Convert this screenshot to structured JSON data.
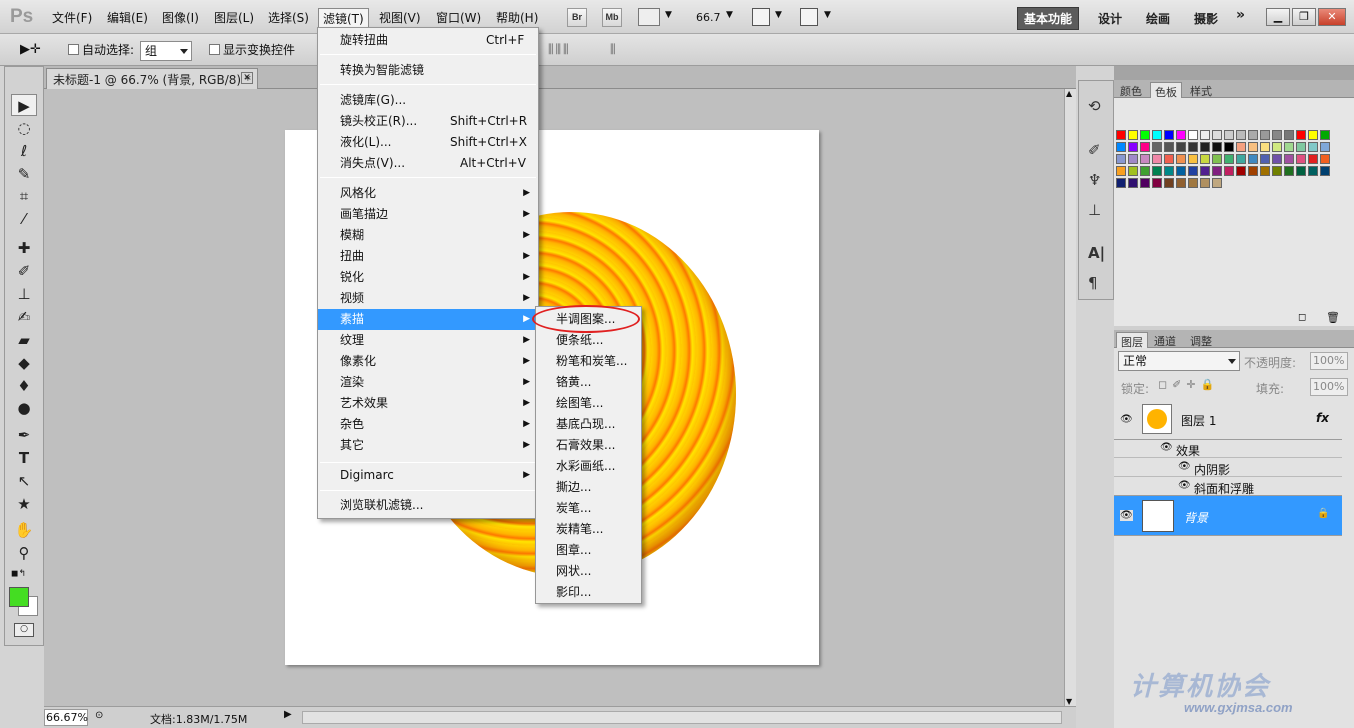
{
  "app": {
    "logo": "Ps"
  },
  "menubar": {
    "items": [
      "文件(F)",
      "编辑(E)",
      "图像(I)",
      "图层(L)",
      "选择(S)",
      "滤镜(T)",
      "视图(V)",
      "窗口(W)",
      "帮助(H)"
    ],
    "zoom": "66.7",
    "bridge_btn": "Br",
    "minibridge_btn": "Mb",
    "workspaces": [
      "基本功能",
      "设计",
      "绘画",
      "摄影"
    ],
    "more": "»"
  },
  "options": {
    "auto_select_label": "自动选择:",
    "auto_select_value": "组",
    "show_transform_label": "显示变换控件"
  },
  "document": {
    "tab_title": "未标题-1 @ 66.7% (背景, RGB/8) *"
  },
  "status": {
    "zoom": "66.67%",
    "doc_info": "文档:1.83M/1.75M"
  },
  "panels": {
    "color_tabs": [
      "颜色",
      "色板",
      "样式"
    ],
    "layer_tabs": [
      "图层",
      "通道",
      "调整"
    ],
    "blend_mode": "正常",
    "opacity_label": "不透明度:",
    "opacity_value": "100%",
    "lock_label": "锁定:",
    "fill_label": "填充:",
    "fill_value": "100%",
    "layers": [
      {
        "name": "图层 1",
        "fx": "fx"
      },
      {
        "name": "背景"
      }
    ],
    "effects_label": "效果",
    "effects": [
      "内阴影",
      "斜面和浮雕"
    ]
  },
  "filter_menu": {
    "top": [
      {
        "label": "旋转扭曲",
        "shortcut": "Ctrl+F"
      }
    ],
    "smart": "转换为智能滤镜",
    "group2": [
      {
        "label": "滤镜库(G)...",
        "shortcut": ""
      },
      {
        "label": "镜头校正(R)...",
        "shortcut": "Shift+Ctrl+R"
      },
      {
        "label": "液化(L)...",
        "shortcut": "Shift+Ctrl+X"
      },
      {
        "label": "消失点(V)...",
        "shortcut": "Alt+Ctrl+V"
      }
    ],
    "submenus": [
      "风格化",
      "画笔描边",
      "模糊",
      "扭曲",
      "锐化",
      "视频",
      "素描",
      "纹理",
      "像素化",
      "渲染",
      "艺术效果",
      "杂色",
      "其它"
    ],
    "digimarc": "Digimarc",
    "browse": "浏览联机滤镜..."
  },
  "sketch_menu": {
    "items": [
      "半调图案...",
      "便条纸...",
      "粉笔和炭笔...",
      "铬黄...",
      "绘图笔...",
      "基底凸现...",
      "石膏效果...",
      "水彩画纸...",
      "撕边...",
      "炭笔...",
      "炭精笔...",
      "图章...",
      "网状...",
      "影印..."
    ]
  },
  "watermark": {
    "text": "计算机协会",
    "url": "www.gxjmsa.com"
  },
  "colors": {
    "highlight": "#3399ff",
    "foreground": "#44dd22",
    "annotation": "#e02020"
  },
  "swatch_colors": [
    "#ff0000",
    "#ffff00",
    "#00ff00",
    "#00ffff",
    "#0000ff",
    "#ff00ff",
    "#ffffff",
    "#eeeeee",
    "#dddddd",
    "#cccccc",
    "#bbbbbb",
    "#aaaaaa",
    "#999999",
    "#888888",
    "#777777",
    "#ff0000",
    "#ffff00",
    "#00aa00",
    "#0088ff",
    "#8800ff",
    "#ff0088",
    "#666666",
    "#555555",
    "#444444",
    "#333333",
    "#222222",
    "#111111",
    "#000000",
    "#f4a080",
    "#f8c080",
    "#fbe080",
    "#d0e880",
    "#a0d890",
    "#80c8a0",
    "#80c8c8",
    "#80a8d8",
    "#8898d0",
    "#a088c8",
    "#c888c0",
    "#f088a8",
    "#f06050",
    "#f09050",
    "#f8c040",
    "#c8d840",
    "#80c050",
    "#40b070",
    "#40a8a0",
    "#4088c0",
    "#5060b0",
    "#7050a8",
    "#a050a0",
    "#e05080",
    "#e02020",
    "#f06020",
    "#f8a020",
    "#a0c020",
    "#40a030",
    "#008050",
    "#008888",
    "#0060a0",
    "#2040a0",
    "#502090",
    "#802080",
    "#c02060",
    "#a00000",
    "#a04000",
    "#a07000",
    "#708000",
    "#207020",
    "#006040",
    "#006060",
    "#004070",
    "#102070",
    "#301070",
    "#500060",
    "#800040",
    "#704020",
    "#906030",
    "#a07840",
    "#b09060",
    "#c0a880"
  ]
}
